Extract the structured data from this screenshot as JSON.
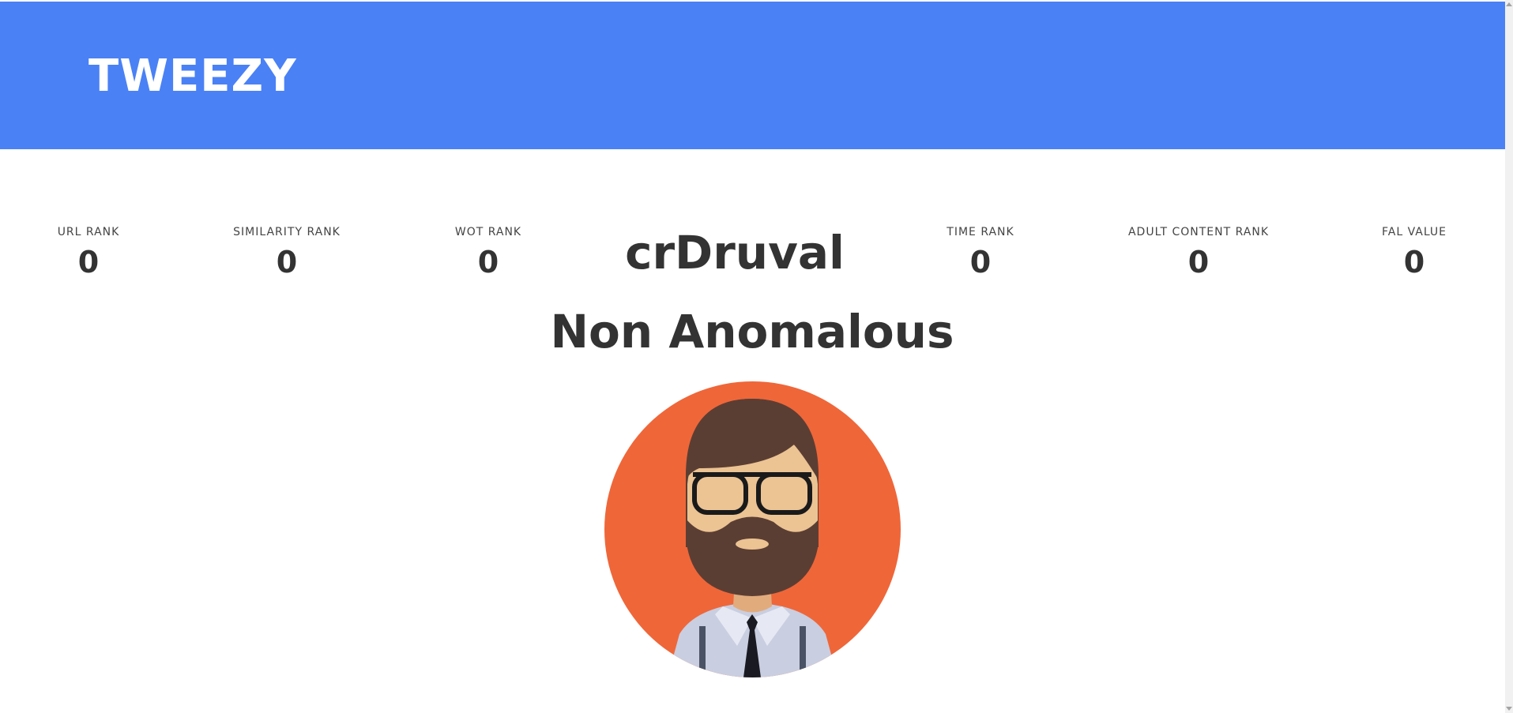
{
  "header": {
    "brand": "TWEEZY",
    "color": "#4a81f5"
  },
  "stats_left": [
    {
      "label": "URL RANK",
      "value": "0"
    },
    {
      "label": "SIMILARITY RANK",
      "value": "0"
    },
    {
      "label": "WOT RANK",
      "value": "0"
    }
  ],
  "stats_right": [
    {
      "label": "TIME RANK",
      "value": "0"
    },
    {
      "label": "ADULT CONTENT RANK",
      "value": "0"
    },
    {
      "label": "FAL VALUE",
      "value": "0"
    }
  ],
  "profile": {
    "username": "crDruval",
    "verdict": "Non Anomalous",
    "avatar_icon": "bearded-man-avatar",
    "avatar_background": "#ef6639"
  }
}
